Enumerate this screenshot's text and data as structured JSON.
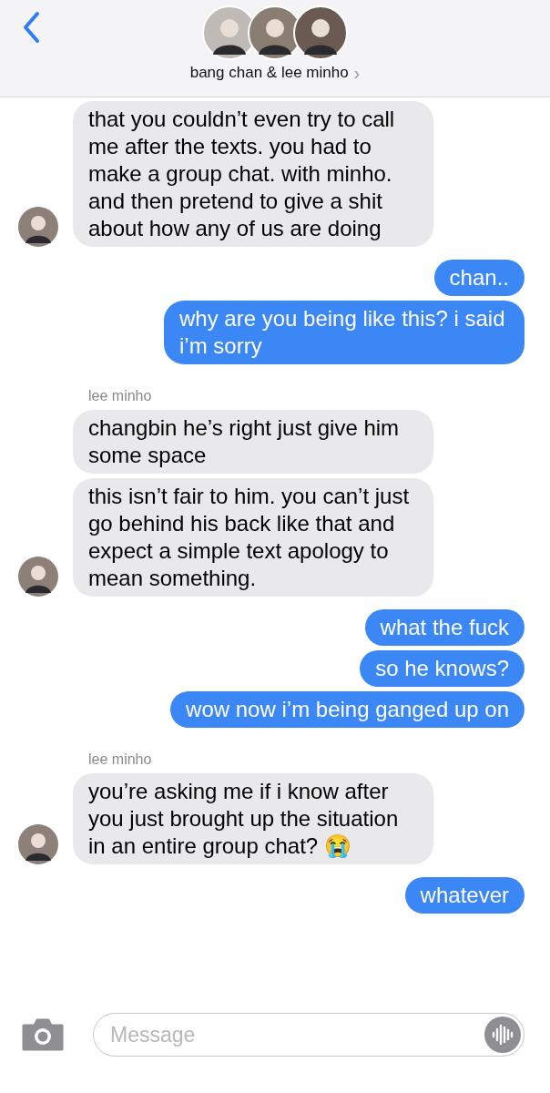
{
  "header": {
    "title": "bang chan & lee minho",
    "chevron": "›"
  },
  "messages": [
    {
      "kind": "incoming",
      "text": "that you couldn’t even try to call me after the texts. you had to make a group chat. with minho. and then pretend to give a shit about how any of us are doing",
      "avatar": true
    },
    {
      "kind": "outgoing",
      "text": "chan.."
    },
    {
      "kind": "outgoing",
      "text": "why are you being like this? i said i’m sorry"
    },
    {
      "kind": "sender",
      "text": "lee minho"
    },
    {
      "kind": "incoming",
      "text": "changbin he’s right just give him some space",
      "avatar": false
    },
    {
      "kind": "incoming",
      "text": "this isn’t fair to him. you can’t just go behind his back like that and expect a simple text apology to mean something.",
      "avatar": true
    },
    {
      "kind": "outgoing",
      "text": "what the fuck"
    },
    {
      "kind": "outgoing",
      "text": "so he knows?"
    },
    {
      "kind": "outgoing",
      "text": "wow now i’m being ganged up on"
    },
    {
      "kind": "sender",
      "text": "lee minho"
    },
    {
      "kind": "incoming",
      "text": "you’re asking me if i know after you just brought up the situation in an entire group chat? 😭",
      "avatar": true
    },
    {
      "kind": "outgoing",
      "text": "whatever"
    }
  ],
  "composer": {
    "placeholder": "Message"
  }
}
